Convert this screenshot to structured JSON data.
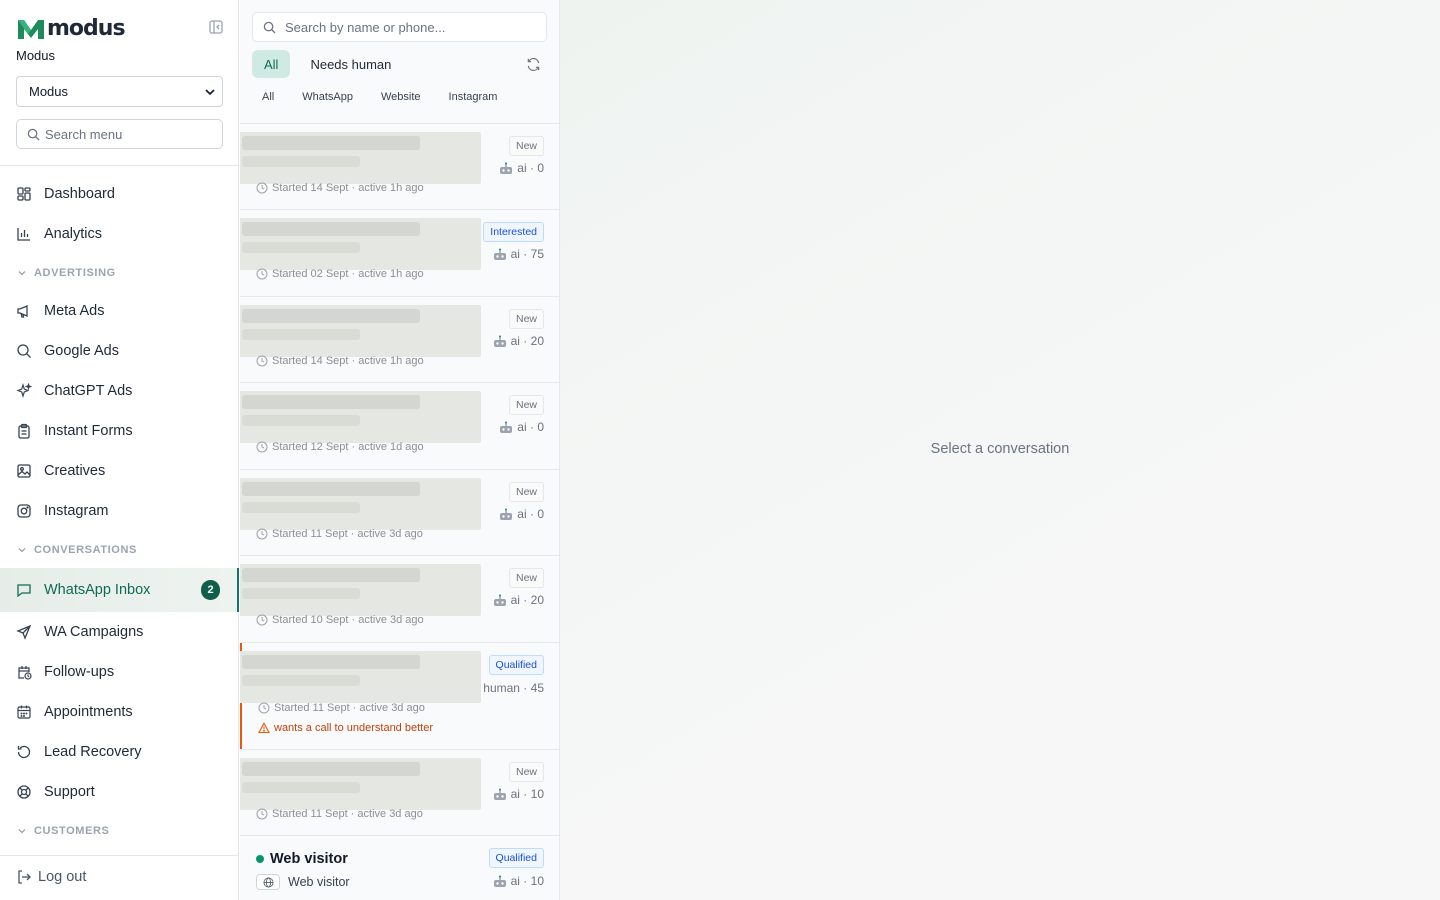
{
  "brand": {
    "logo_text": "modus",
    "org_name": "Modus",
    "org_select_value": "Modus",
    "accent": "#0f766e"
  },
  "sidebar": {
    "search_placeholder": "Search menu",
    "items": [
      {
        "label": "Dashboard",
        "icon": "grid-icon"
      },
      {
        "label": "Analytics",
        "icon": "bar-chart-icon"
      }
    ],
    "sections": [
      {
        "title": "ADVERTISING",
        "items": [
          {
            "label": "Meta Ads",
            "icon": "megaphone-icon"
          },
          {
            "label": "Google Ads",
            "icon": "search-icon"
          },
          {
            "label": "ChatGPT Ads",
            "icon": "sparkles-icon"
          },
          {
            "label": "Instant Forms",
            "icon": "clipboard-icon"
          },
          {
            "label": "Creatives",
            "icon": "image-icon"
          },
          {
            "label": "Instagram",
            "icon": "instagram-icon"
          }
        ]
      },
      {
        "title": "CONVERSATIONS",
        "items": [
          {
            "label": "WhatsApp Inbox",
            "icon": "message-icon",
            "badge": "2",
            "active": true
          },
          {
            "label": "WA Campaigns",
            "icon": "send-icon"
          },
          {
            "label": "Follow-ups",
            "icon": "calendar-clock-icon"
          },
          {
            "label": "Appointments",
            "icon": "calendar-icon"
          },
          {
            "label": "Lead Recovery",
            "icon": "rotate-icon"
          },
          {
            "label": "Support",
            "icon": "lifebuoy-icon"
          }
        ]
      },
      {
        "title": "CUSTOMERS",
        "items": []
      }
    ],
    "logout_label": "Log out"
  },
  "conversations": {
    "search_placeholder": "Search by name or phone...",
    "filters": [
      "All",
      "Needs human"
    ],
    "active_filter": "All",
    "channels": [
      "All",
      "WhatsApp",
      "Website",
      "Instagram"
    ],
    "items": [
      {
        "status": "New",
        "handler": "ai",
        "score": "0",
        "started": "Started 14 Sept · active 1h ago"
      },
      {
        "status": "Interested",
        "handler": "ai",
        "score": "75",
        "started": "Started 02 Sept · active 1h ago"
      },
      {
        "status": "New",
        "handler": "ai",
        "score": "20",
        "started": "Started 14 Sept · active 1h ago"
      },
      {
        "status": "New",
        "handler": "ai",
        "score": "0",
        "started": "Started 12 Sept · active 1d ago"
      },
      {
        "status": "New",
        "handler": "ai",
        "score": "0",
        "started": "Started 11 Sept · active 3d ago"
      },
      {
        "status": "New",
        "handler": "ai",
        "score": "20",
        "started": "Started 10 Sept · active 3d ago"
      },
      {
        "status": "Qualified",
        "handler": "human",
        "score": "45",
        "started": "Started 11 Sept · active 3d ago",
        "warning": "wants a call to understand better"
      },
      {
        "status": "New",
        "handler": "ai",
        "score": "10",
        "started": "Started 11 Sept · active 3d ago"
      }
    ],
    "visitor": {
      "name": "Web visitor",
      "source": "Web visitor",
      "status": "Qualified",
      "handler": "ai",
      "score": "10"
    }
  },
  "main": {
    "empty_text": "Select a conversation"
  }
}
